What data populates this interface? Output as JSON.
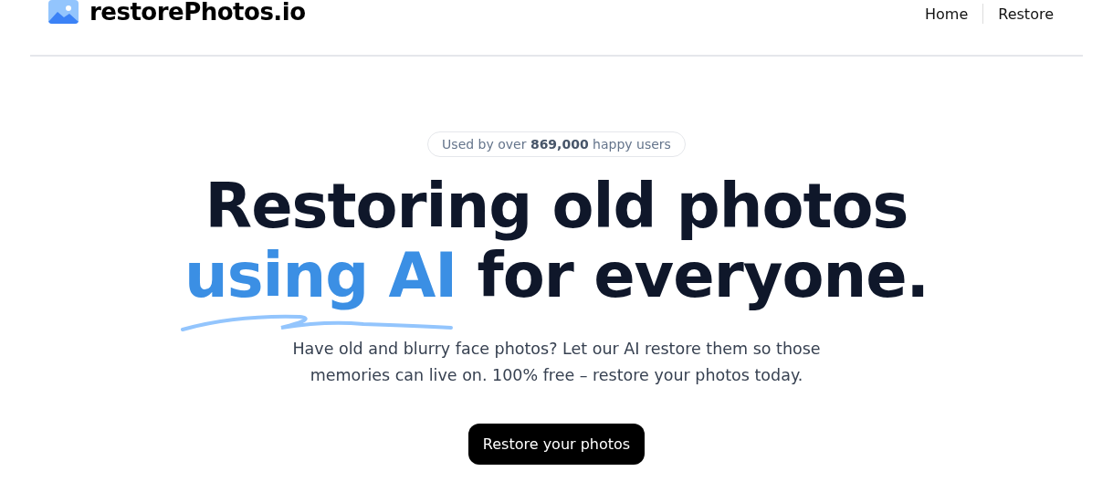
{
  "header": {
    "logo_text": "restorePhotos.io",
    "nav": [
      {
        "label": "Home"
      },
      {
        "label": "Restore"
      }
    ]
  },
  "badge": "Used by over **869,000** happy users",
  "heading": {
    "line_1": "Restoring old photos",
    "highlight": "using AI",
    "rest": "for everyone."
  },
  "description": "Have old and blurry face photos? Let our AI restore them so those memories can live on. 100% free – restore your photos today.",
  "cta_button": "Restore your photos"
}
